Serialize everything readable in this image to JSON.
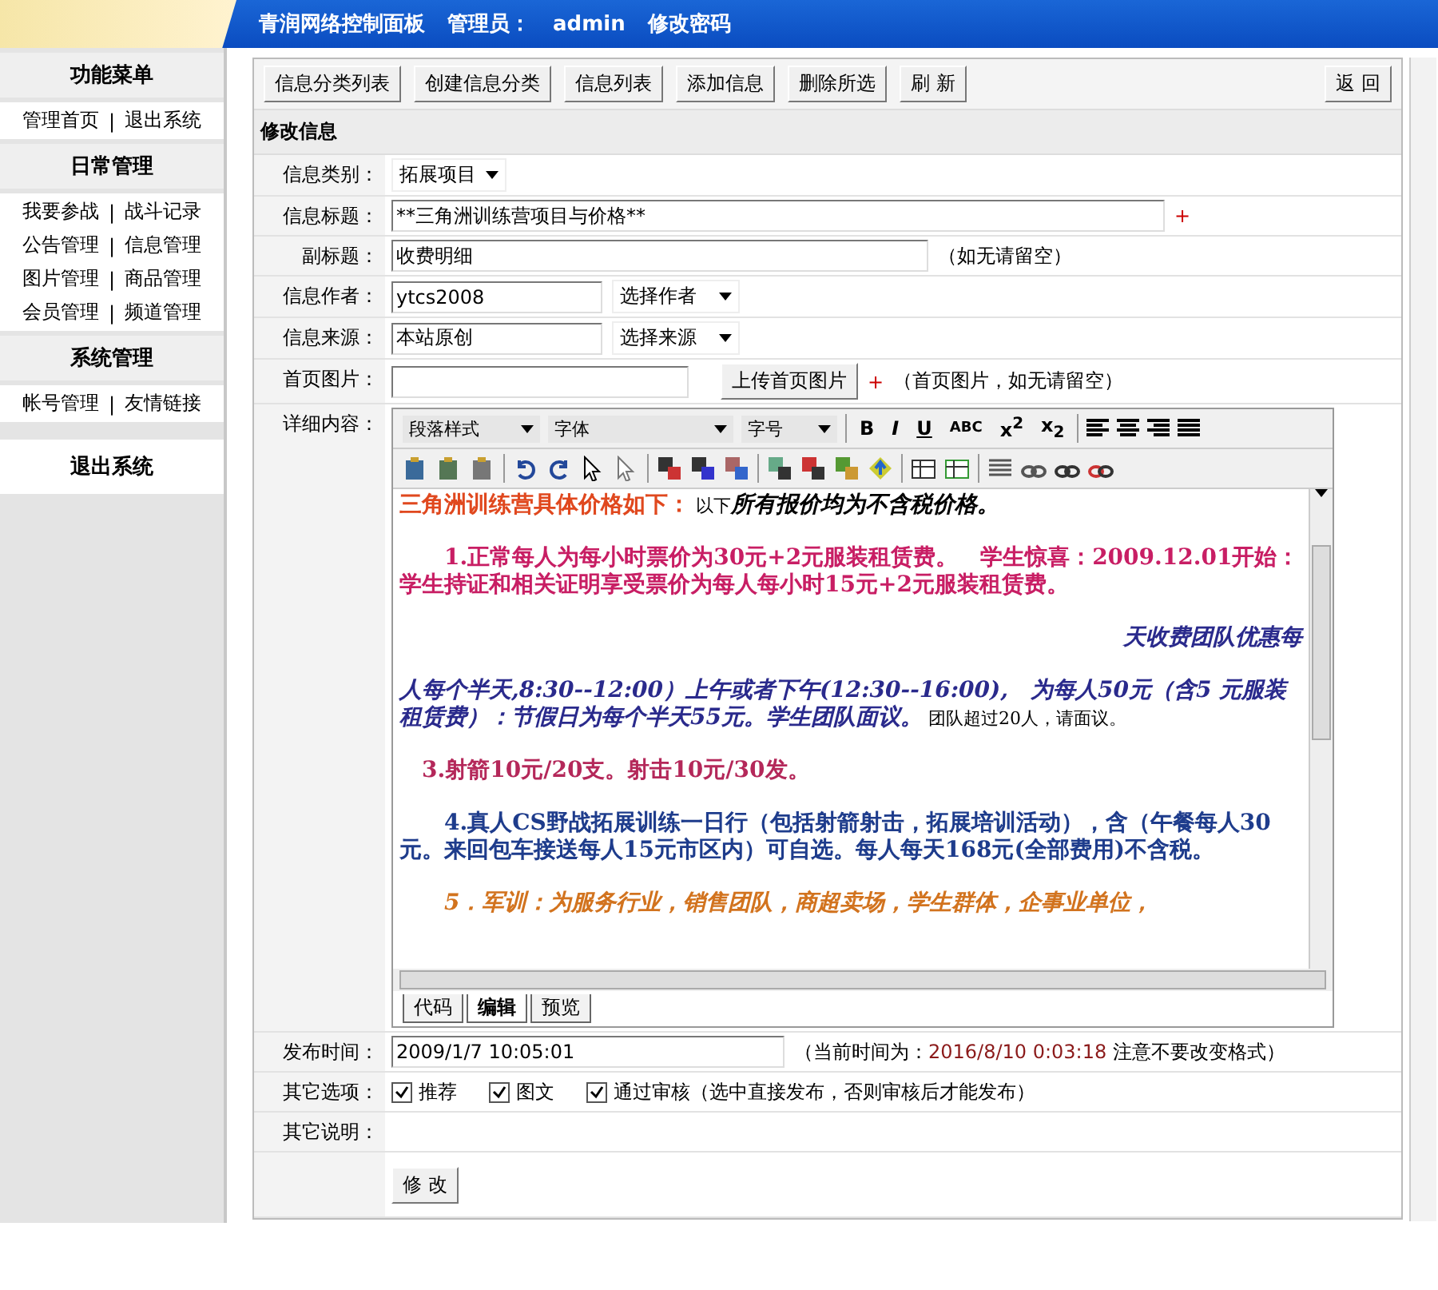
{
  "header": {
    "title": "青润网络控制面板",
    "admin_label": "管理员：",
    "admin_name": "admin",
    "change_password": "修改密码"
  },
  "sidebar": {
    "sections": [
      {
        "title": "功能菜单",
        "rows": [
          [
            "管理首页",
            "|",
            "退出系统"
          ]
        ]
      },
      {
        "title": "日常管理",
        "rows": [
          [
            "我要参战",
            "|",
            "战斗记录"
          ],
          [
            "公告管理",
            "|",
            "信息管理"
          ],
          [
            "图片管理",
            "|",
            "商品管理"
          ],
          [
            "会员管理",
            "|",
            "频道管理"
          ]
        ]
      },
      {
        "title": "系统管理",
        "rows": [
          [
            "帐号管理",
            "|",
            "友情链接"
          ]
        ]
      }
    ],
    "logout": "退出系统"
  },
  "toolbar": {
    "buttons": [
      "信息分类列表",
      "创建信息分类",
      "信息列表",
      "添加信息",
      "删除所选",
      "刷 新"
    ],
    "back": "返 回"
  },
  "section_title": "修改信息",
  "form": {
    "category": {
      "label": "信息类别：",
      "value": "拓展项目"
    },
    "title": {
      "label": "信息标题：",
      "value": "**三角洲训练营项目与价格**",
      "mark": "+"
    },
    "subtitle": {
      "label": "副标题：",
      "value": "收费明细",
      "hint": "（如无请留空）"
    },
    "author": {
      "label": "信息作者：",
      "value": "ytcs2008",
      "picker": "选择作者"
    },
    "source": {
      "label": "信息来源：",
      "value": "本站原创",
      "picker": "选择来源"
    },
    "home_image": {
      "label": "首页图片：",
      "upload": "上传首页图片",
      "mark": "+",
      "hint": "（首页图片，如无请留空）"
    },
    "content": {
      "label": "详细内容：",
      "selects": [
        "段落样式",
        "字体",
        "字号"
      ],
      "format_buttons": [
        {
          "kind": "bold",
          "label": "B"
        },
        {
          "kind": "italic",
          "label": "I"
        },
        {
          "kind": "underline",
          "label": "U"
        },
        {
          "kind": "strike",
          "label": "ABC"
        },
        {
          "kind": "script",
          "label": "x$^{2}$"
        },
        {
          "kind": "script",
          "label": "x$_{2}$"
        }
      ],
      "paragraphs": [
        {
          "kind": "normal",
          "runs": [
            {
              "text": "三角洲训练营具体价格如下：",
              "color": "#e0481e",
              "kind": "strong"
            },
            {
              "text": " 以下",
              "color": "#000000",
              "kind": "note"
            },
            {
              "text": "所有报价均为不含税价格。",
              "color": "#000000",
              "kind": "emphasis"
            }
          ]
        },
        {
          "kind": "normal",
          "runs": [
            {
              "text": "　　1.正常每人为每小时票价为30元+2元服装租赁费。　学生惊喜：2009.12.01开始：学生持证和相关证明享受票价为每人每小时15元+2元服装租赁费。",
              "color": "#c81e64",
              "kind": "strong"
            }
          ]
        },
        {
          "kind": "fragment",
          "runs": [
            {
              "text": "天收费团队优惠每",
              "color": "#2a2a8c",
              "kind": "emphasis"
            }
          ]
        },
        {
          "kind": "normal",
          "runs": [
            {
              "text": "人每个半天,8:30--12:00）上午或者下午(12:30--16:00),　为每人50元（含5 元服装租赁费）：节假日为每个半天55元。学生团队面议。",
              "color": "#2a2a8c",
              "kind": "emphasis"
            },
            {
              "text": " 团队超过20人，请面议。",
              "color": "#000000",
              "kind": "note"
            }
          ]
        },
        {
          "kind": "normal",
          "runs": [
            {
              "text": "　3.射箭10元/20支。射击10元/30发。",
              "color": "#b4285a",
              "kind": "strong"
            }
          ]
        },
        {
          "kind": "normal",
          "runs": [
            {
              "text": "　　4.真人CS野战拓展训练一日行（包括射箭射击，拓展培训活动），含（午餐每人30元。来回包车接送每人15元市区内）可自选。每人每天168元(全部费用)不含税。",
              "color": "#1e3c8c",
              "kind": "strong"
            }
          ]
        },
        {
          "kind": "normal",
          "runs": [
            {
              "text": "　　5．军训：为服务行业，销售团队，商超卖场，学生群体，企事业单位，",
              "color": "#d2731e",
              "kind": "emphasis"
            }
          ]
        }
      ],
      "modes": [
        {
          "label": "代码",
          "selected": false
        },
        {
          "label": "编辑",
          "selected": true
        },
        {
          "label": "预览",
          "selected": false
        }
      ]
    },
    "publish_time": {
      "label": "发布时间：",
      "value": "2009/1/7 10:05:01",
      "hint_prefix": "（当前时间为：",
      "current": "2016/8/10 0:03:18",
      "hint_suffix": " 注意不要改变格式）"
    },
    "options": {
      "label": "其它选项：",
      "items": [
        {
          "label": "推荐",
          "checked": true
        },
        {
          "label": "图文",
          "checked": true
        },
        {
          "label": "通过审核（选中直接发布，否则审核后才能发布）",
          "checked": true
        }
      ]
    },
    "remark": {
      "label": "其它说明："
    },
    "submit": "修 改"
  }
}
